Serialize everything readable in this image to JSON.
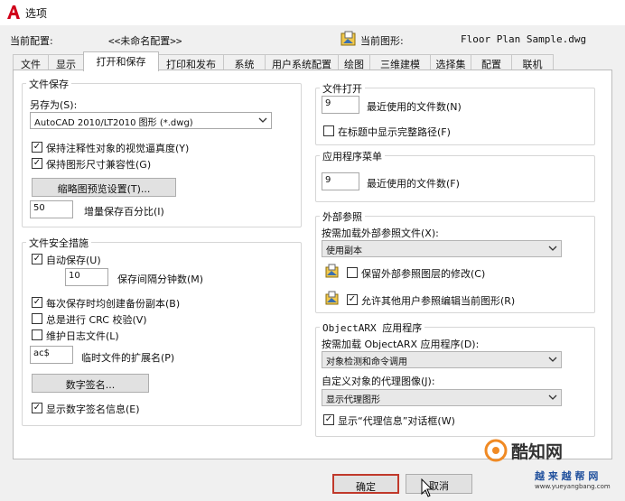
{
  "window": {
    "title": "选项",
    "icon": "autocad-a-icon"
  },
  "profile": {
    "current_profile_label": "当前配置:",
    "current_profile_value": "<<未命名配置>>",
    "current_drawing_label": "当前图形:",
    "current_drawing_value": "Floor Plan Sample.dwg"
  },
  "tabs": [
    "文件",
    "显示",
    "打开和保存",
    "打印和发布",
    "系统",
    "用户系统配置",
    "绘图",
    "三维建模",
    "选择集",
    "配置",
    "联机"
  ],
  "active_tab": "打开和保存",
  "file_save": {
    "title": "文件保存",
    "save_as_label": "另存为(S):",
    "save_as_value": "AutoCAD 2010/LT2010 图形 (*.dwg)",
    "keep_annotative_label": "保持注释性对象的视觉逼真度(Y)",
    "keep_annotative_checked": true,
    "keep_drawing_size_label": "保持图形尺寸兼容性(G)",
    "keep_drawing_size_checked": true,
    "thumbnail_button": "缩略图预览设置(T)...",
    "incremental_value": "50",
    "incremental_label": "增量保存百分比(I)"
  },
  "file_safety": {
    "title": "文件安全措施",
    "autosave_label": "自动保存(U)",
    "autosave_checked": true,
    "interval_value": "10",
    "interval_label": "保存间隔分钟数(M)",
    "backup_label": "每次保存时均创建备份副本(B)",
    "backup_checked": true,
    "crc_label": "总是进行 CRC 校验(V)",
    "crc_checked": false,
    "log_label": "维护日志文件(L)",
    "log_checked": false,
    "temp_ext_value": "ac$",
    "temp_ext_label": "临时文件的扩展名(P)",
    "digital_sig_button": "数字签名...",
    "show_sig_label": "显示数字签名信息(E)",
    "show_sig_checked": true
  },
  "file_open": {
    "title": "文件打开",
    "recent_value": "9",
    "recent_label": "最近使用的文件数(N)",
    "full_path_label": "在标题中显示完整路径(F)",
    "full_path_checked": false
  },
  "app_menu": {
    "title": "应用程序菜单",
    "recent_value": "9",
    "recent_label": "最近使用的文件数(F)"
  },
  "xref": {
    "title": "外部参照",
    "demand_load_label": "按需加载外部参照文件(X):",
    "demand_load_value": "使用副本",
    "retain_label": "保留外部参照图层的修改(C)",
    "retain_checked": false,
    "allow_edit_label": "允许其他用户参照编辑当前图形(R)",
    "allow_edit_checked": true
  },
  "objectarx": {
    "title": "ObjectARX 应用程序",
    "demand_load_label": "按需加载 ObjectARX 应用程序(D):",
    "demand_load_value": "对象检测和命令调用",
    "proxy_label": "自定义对象的代理图像(J):",
    "proxy_value": "显示代理图形",
    "show_proxy_label": "显示“代理信息”对话框(W)",
    "show_proxy_checked": true
  },
  "buttons": {
    "ok": "确定",
    "cancel": "取消"
  },
  "watermark": {
    "text": "酷知网",
    "text2": "越 来 越 帮 网",
    "url": "www.yueyangbang.com"
  },
  "colors": {
    "accent_red": "#d0021b",
    "ok_highlight": "#c0392b",
    "watermark_orange": "#f08a24"
  }
}
